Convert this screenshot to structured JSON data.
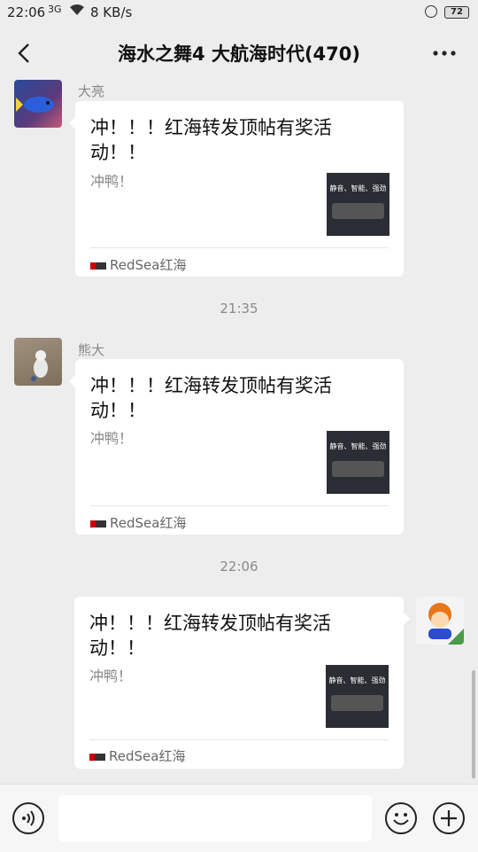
{
  "status_bar": {
    "time": "22:06",
    "signal": "3G",
    "speed": "8 KB/s",
    "battery": "72"
  },
  "title_bar": {
    "title": "海水之舞4 大航海时代(470)"
  },
  "messages": [
    {
      "sender": "大亮",
      "title": "冲！！！红海转发顶帖有奖活动！！",
      "desc": "冲鸭！",
      "thumb_text": "静音、智能、强劲",
      "source": "RedSea红海"
    },
    {
      "sender": "熊大",
      "title": "冲！！！红海转发顶帖有奖活动！！",
      "desc": "冲鸭！",
      "thumb_text": "静音、智能、强劲",
      "source": "RedSea红海"
    },
    {
      "sender": "",
      "title": "冲！！！红海转发顶帖有奖活动！！",
      "desc": "冲鸭！",
      "thumb_text": "静音、智能、强劲",
      "source": "RedSea红海"
    }
  ],
  "timestamps": [
    "21:35",
    "22:06"
  ],
  "input": {
    "placeholder": ""
  },
  "colors": {
    "background": "#ededed",
    "card": "#ffffff",
    "muted_text": "#888888"
  }
}
